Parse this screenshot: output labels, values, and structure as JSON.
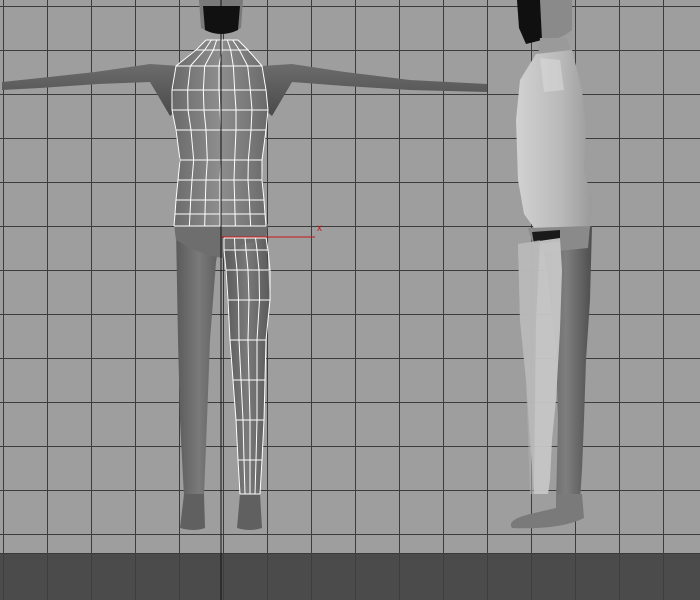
{
  "viewport": {
    "background": "#9e9e9e",
    "grid_color": "#3c3c3c",
    "grid_spacing_units": 1
  },
  "floor": {
    "color": "#4b4b4b"
  },
  "front_figure": {
    "body_color": "#707070",
    "wireframe_color": "#ffffff",
    "selected_parts": [
      "torso",
      "right-leg"
    ]
  },
  "side_figure": {
    "body_color": "#8a8a8a",
    "highlight_color": "#c8c8c8"
  },
  "gizmo": {
    "axis_label": "x",
    "axis_color": "#c81818"
  }
}
